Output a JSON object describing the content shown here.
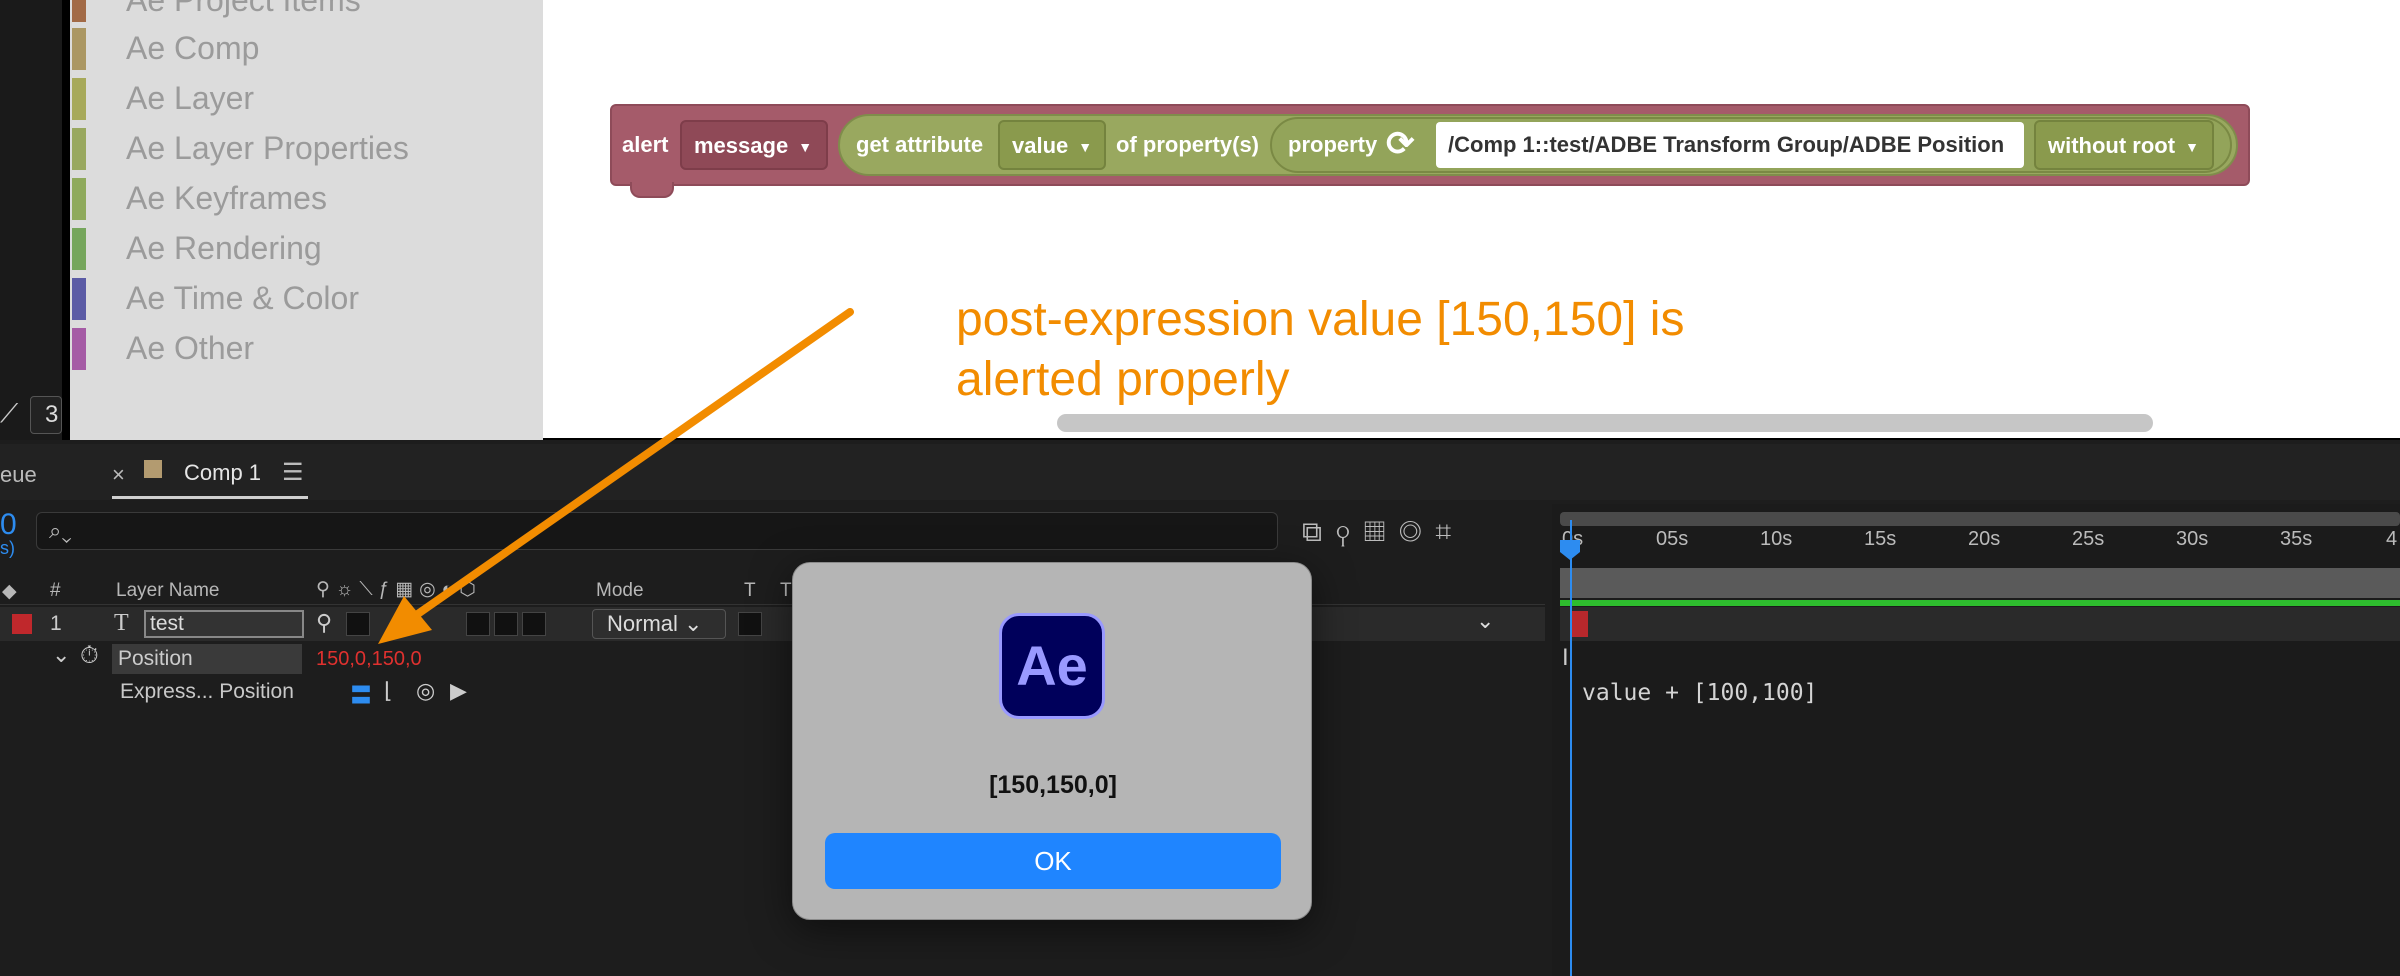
{
  "toolbox": {
    "categories": [
      {
        "label": "Ae Project Items",
        "color": "#a26a46"
      },
      {
        "label": "Ae Comp",
        "color": "#ab9763"
      },
      {
        "label": "Ae Layer",
        "color": "#a7a95a"
      },
      {
        "label": "Ae Layer Properties",
        "color": "#99a85f"
      },
      {
        "label": "Ae Keyframes",
        "color": "#8faa5c"
      },
      {
        "label": "Ae Rendering",
        "color": "#76a65c"
      },
      {
        "label": "Ae Time & Color",
        "color": "#5b5ba5"
      },
      {
        "label": "Ae Other",
        "color": "#a55ba5"
      }
    ],
    "counter": "3"
  },
  "block": {
    "alert": "alert",
    "message_dropdown": "message",
    "get_attribute": "get attribute",
    "attribute_dropdown": "value",
    "of_property": "of property(s)",
    "property": "property",
    "path": "/Comp 1::test/ADBE Transform Group/ADBE Position",
    "root_dropdown": "without root"
  },
  "annotation": {
    "line1": "post-expression value [150,150] is",
    "line2": "alerted properly"
  },
  "panel": {
    "left_tab": "eue",
    "close": "×",
    "comp_tab": "Comp 1",
    "menu": "☰",
    "time": "0",
    "fps": "s)",
    "search_icon": "search-icon"
  },
  "columns": {
    "hash": "#",
    "layer_name": "Layer Name",
    "mode": "Mode",
    "t": "T",
    "trkmat": "Tr"
  },
  "layer": {
    "index": "1",
    "type_glyph": "T",
    "name": "test",
    "mode": "Normal",
    "position_label": "Position",
    "position_x": "150,0",
    "position_y": "150,0",
    "expression_label": "Express... Position",
    "expression_text": "value + [100,100]"
  },
  "ruler": {
    "ticks": [
      "0s",
      "05s",
      "10s",
      "15s",
      "20s",
      "25s",
      "30s",
      "35s",
      "4"
    ]
  },
  "dialog": {
    "icon_text": "Ae",
    "message": "[150,150,0]",
    "ok_label": "OK"
  },
  "colors": {
    "accent_blue": "#2d8cf0",
    "annotation_orange": "#f28c00",
    "alert_block": "#a55b6a",
    "property_block": "#99a85f",
    "ok_button": "#1f85ff"
  }
}
